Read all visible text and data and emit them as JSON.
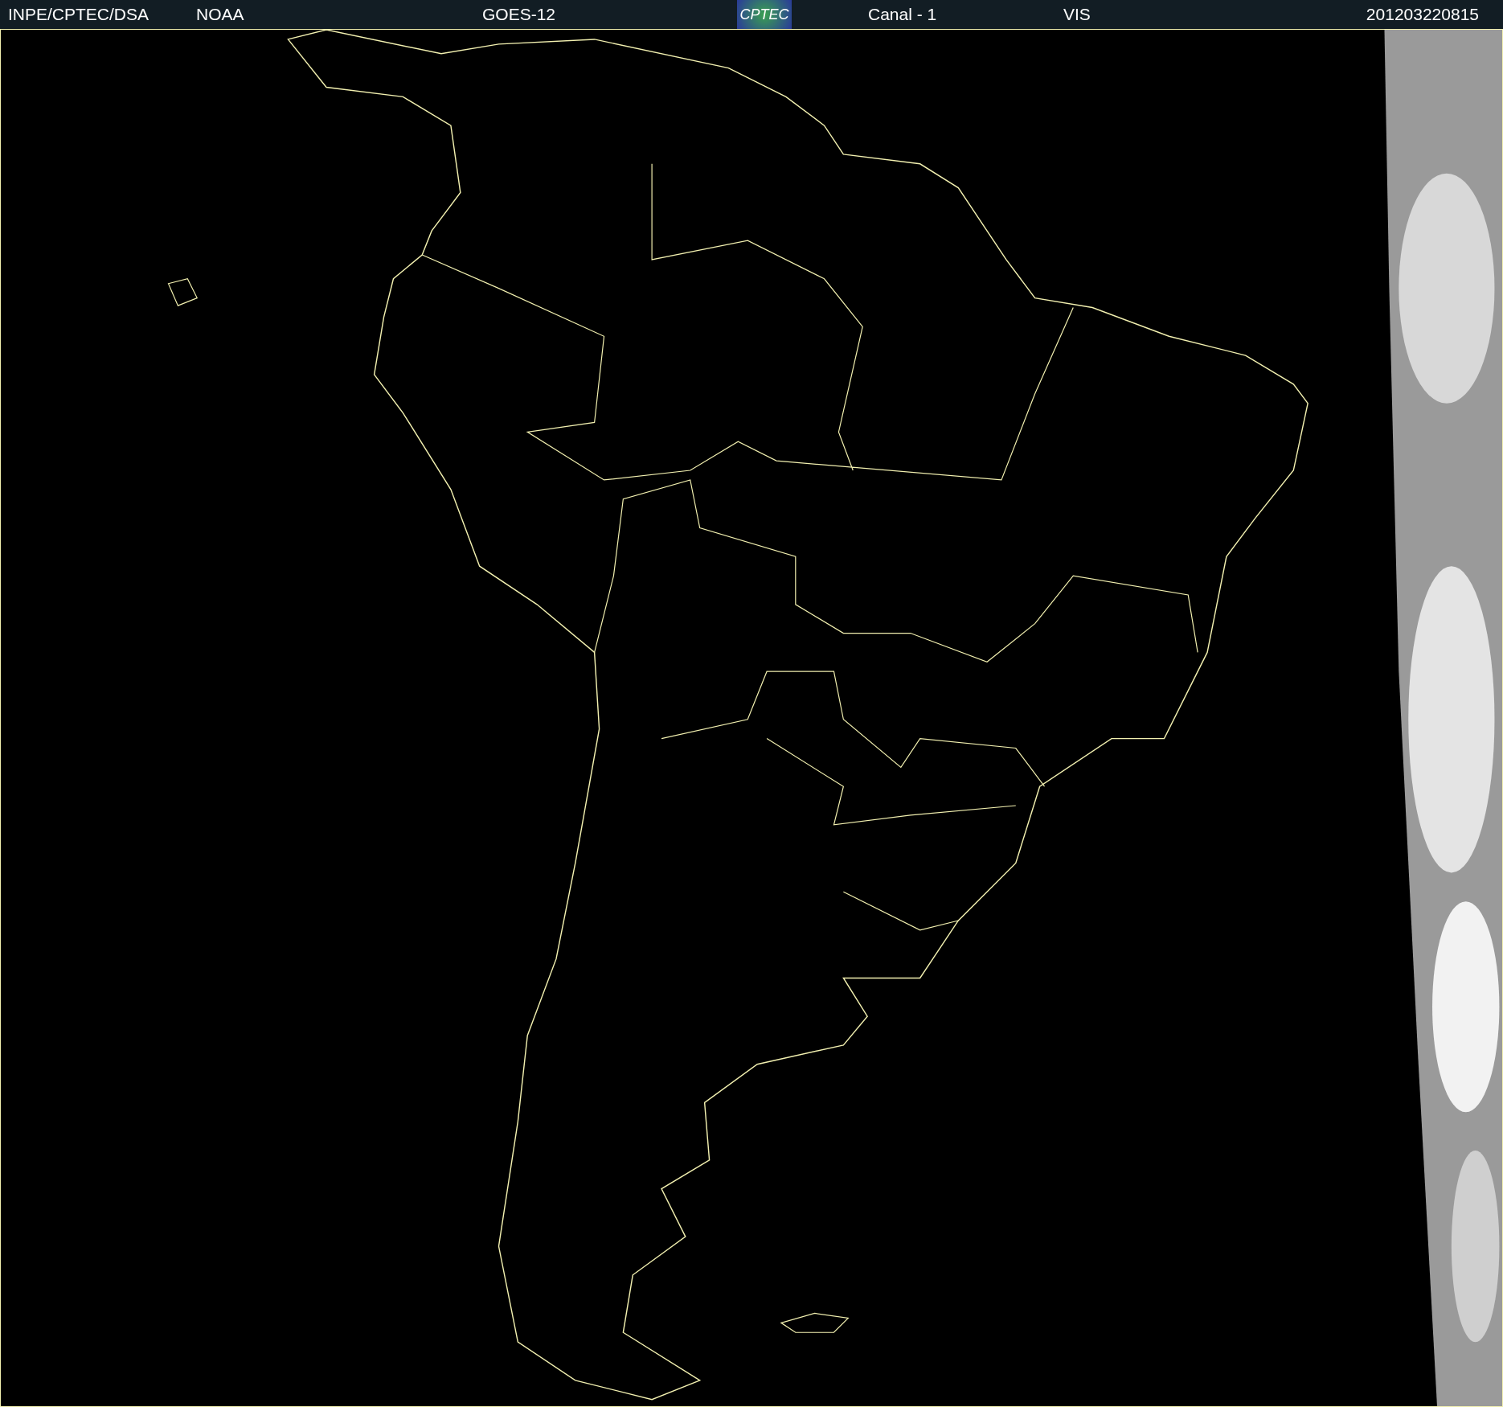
{
  "header": {
    "source": "INPE/CPTEC/DSA",
    "agency": "NOAA",
    "satellite": "GOES-12",
    "logo": "CPTEC",
    "channel": "Canal - 1",
    "band": "VIS",
    "timestamp": "201203220815"
  }
}
